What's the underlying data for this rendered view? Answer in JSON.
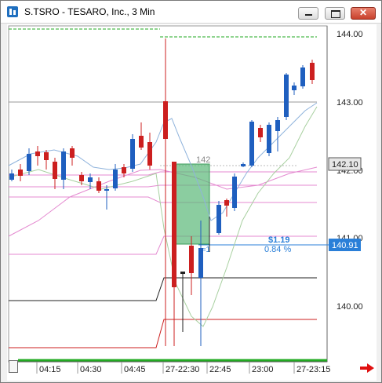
{
  "window": {
    "title": "S.TSRO - TESARO, Inc., 3 Min",
    "buttons": {
      "minimize": "minimize",
      "maximize": "maximize",
      "close": "✕"
    }
  },
  "price_axis": {
    "ticks": [
      "144.00",
      "143.00",
      "142.00",
      "141.00",
      "140.00"
    ],
    "current_price_label": "142.10",
    "order_price_label": "140.91"
  },
  "time_axis": {
    "ticks": [
      "04:15",
      "04:30",
      "04:45",
      "27-22:30",
      "22:45",
      "23:00",
      "27-23:15"
    ]
  },
  "annotations": {
    "level_label": "142",
    "pnl_dollar": "$1.19",
    "pnl_percent": "0.84 %",
    "entry_marker": "≈1"
  },
  "colors": {
    "up": "#1f5fbf",
    "down": "#cc1f1f",
    "ma_blue": "#8fb3dc",
    "ma_green": "#a8d0a0",
    "pink": "#e48ad0",
    "green_dash": "#22aa22",
    "highlight": "#5ab878",
    "label_blue": "#2a7fd8"
  }
}
